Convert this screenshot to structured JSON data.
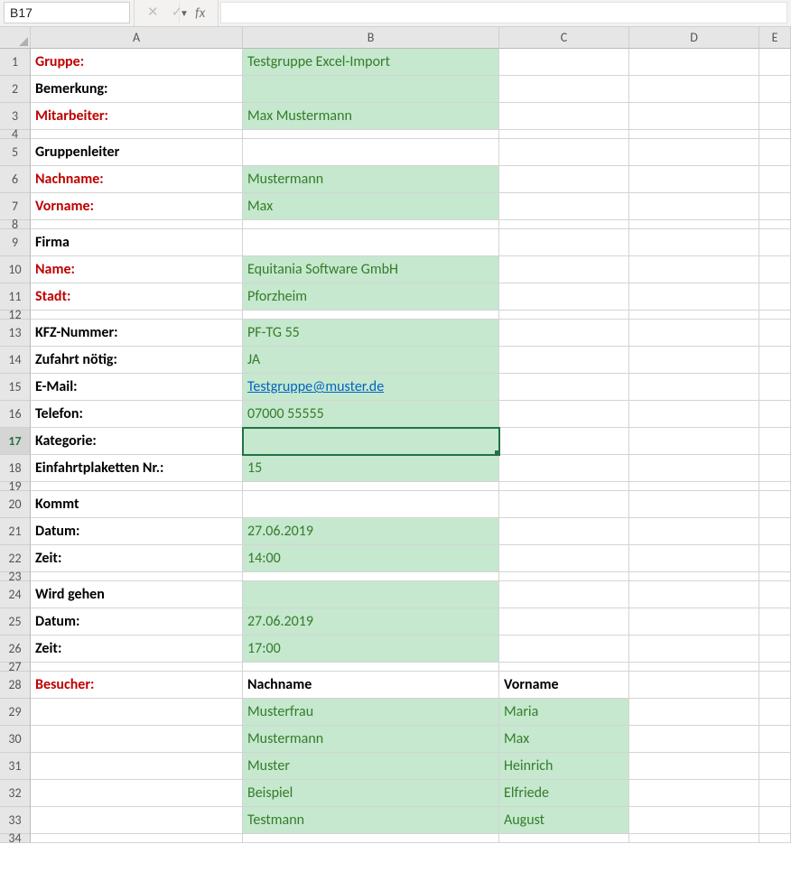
{
  "nameBox": "B17",
  "fx": "fx",
  "cols": [
    "A",
    "B",
    "C",
    "D",
    "E"
  ],
  "rows": [
    {
      "n": "1",
      "h": "rowH",
      "a": "Gruppe:",
      "aCls": "redA",
      "b": "Testgruppe Excel-Import",
      "bCls": "greenB",
      "c": "",
      "cCls": ""
    },
    {
      "n": "2",
      "h": "rowH",
      "a": "Bemerkung:",
      "aCls": "boldA",
      "b": "",
      "bCls": "greenB",
      "c": "",
      "cCls": ""
    },
    {
      "n": "3",
      "h": "rowH",
      "a": "Mitarbeiter:",
      "aCls": "redA",
      "b": "Max Mustermann",
      "bCls": "greenB",
      "c": "",
      "cCls": ""
    },
    {
      "n": "4",
      "h": "rowHs",
      "a": "",
      "aCls": "",
      "b": "",
      "bCls": "",
      "c": "",
      "cCls": ""
    },
    {
      "n": "5",
      "h": "rowH",
      "a": "Gruppenleiter",
      "aCls": "boldA",
      "b": "",
      "bCls": "",
      "c": "",
      "cCls": ""
    },
    {
      "n": "6",
      "h": "rowH",
      "a": "Nachname:",
      "aCls": "redA",
      "b": "Mustermann",
      "bCls": "greenB",
      "c": "",
      "cCls": ""
    },
    {
      "n": "7",
      "h": "rowH",
      "a": "Vorname:",
      "aCls": "redA",
      "b": "Max",
      "bCls": "greenB",
      "c": "",
      "cCls": ""
    },
    {
      "n": "8",
      "h": "rowHs",
      "a": "",
      "aCls": "",
      "b": "",
      "bCls": "",
      "c": "",
      "cCls": ""
    },
    {
      "n": "9",
      "h": "rowH",
      "a": "Firma",
      "aCls": "boldA",
      "b": "",
      "bCls": "",
      "c": "",
      "cCls": ""
    },
    {
      "n": "10",
      "h": "rowH",
      "a": "Name:",
      "aCls": "redA",
      "b": "Equitania Software GmbH",
      "bCls": "greenB",
      "c": "",
      "cCls": ""
    },
    {
      "n": "11",
      "h": "rowH",
      "a": "Stadt:",
      "aCls": "redA",
      "b": "Pforzheim",
      "bCls": "greenB",
      "c": "",
      "cCls": ""
    },
    {
      "n": "12",
      "h": "rowHs",
      "a": "",
      "aCls": "",
      "b": "",
      "bCls": "",
      "c": "",
      "cCls": ""
    },
    {
      "n": "13",
      "h": "rowH",
      "a": "KFZ-Nummer:",
      "aCls": "boldA",
      "b": "PF-TG 55",
      "bCls": "greenB",
      "c": "",
      "cCls": ""
    },
    {
      "n": "14",
      "h": "rowH",
      "a": "Zufahrt nötig:",
      "aCls": "boldA",
      "b": "JA",
      "bCls": "greenB",
      "c": "",
      "cCls": ""
    },
    {
      "n": "15",
      "h": "rowH",
      "a": "E-Mail:",
      "aCls": "boldA",
      "b": "Testgruppe@muster.de",
      "bCls": "greenB linkB",
      "c": "",
      "cCls": ""
    },
    {
      "n": "16",
      "h": "rowH",
      "a": "Telefon:",
      "aCls": "boldA",
      "b": "07000 55555",
      "bCls": "greenB",
      "c": "",
      "cCls": ""
    },
    {
      "n": "17",
      "h": "rowH",
      "a": "Kategorie:",
      "aCls": "boldA",
      "b": "",
      "bCls": "greenB activeSel",
      "c": "",
      "cCls": ""
    },
    {
      "n": "18",
      "h": "rowH",
      "a": "Einfahrtplaketten Nr.:",
      "aCls": "boldA",
      "b": "15",
      "bCls": "greenB",
      "c": "",
      "cCls": ""
    },
    {
      "n": "19",
      "h": "rowHs",
      "a": "",
      "aCls": "",
      "b": "",
      "bCls": "",
      "c": "",
      "cCls": ""
    },
    {
      "n": "20",
      "h": "rowH",
      "a": "Kommt",
      "aCls": "boldA",
      "b": "",
      "bCls": "",
      "c": "",
      "cCls": ""
    },
    {
      "n": "21",
      "h": "rowH",
      "a": "Datum:",
      "aCls": "boldA",
      "b": "27.06.2019",
      "bCls": "greenB",
      "c": "",
      "cCls": ""
    },
    {
      "n": "22",
      "h": "rowH",
      "a": "Zeit:",
      "aCls": "boldA",
      "b": "14:00",
      "bCls": "greenB",
      "c": "",
      "cCls": ""
    },
    {
      "n": "23",
      "h": "rowHs",
      "a": "",
      "aCls": "",
      "b": "",
      "bCls": "",
      "c": "",
      "cCls": ""
    },
    {
      "n": "24",
      "h": "rowH",
      "a": "Wird gehen",
      "aCls": "boldA",
      "b": "",
      "bCls": "greenB",
      "c": "",
      "cCls": ""
    },
    {
      "n": "25",
      "h": "rowH",
      "a": "Datum:",
      "aCls": "boldA",
      "b": "27.06.2019",
      "bCls": "greenB",
      "c": "",
      "cCls": ""
    },
    {
      "n": "26",
      "h": "rowH",
      "a": "Zeit:",
      "aCls": "boldA",
      "b": "17:00",
      "bCls": "greenB",
      "c": "",
      "cCls": ""
    },
    {
      "n": "27",
      "h": "rowHs",
      "a": "",
      "aCls": "",
      "b": "",
      "bCls": "",
      "c": "",
      "cCls": ""
    },
    {
      "n": "28",
      "h": "rowH",
      "a": "Besucher:",
      "aCls": "redA",
      "b": "Nachname",
      "bCls": "boldHdr",
      "c": "Vorname",
      "cCls": "boldHdr"
    },
    {
      "n": "29",
      "h": "rowH",
      "a": "",
      "aCls": "",
      "b": "Musterfrau",
      "bCls": "greenB",
      "c": "Maria",
      "cCls": "greenB"
    },
    {
      "n": "30",
      "h": "rowH",
      "a": "",
      "aCls": "",
      "b": "Mustermann",
      "bCls": "greenB",
      "c": "Max",
      "cCls": "greenB"
    },
    {
      "n": "31",
      "h": "rowH",
      "a": "",
      "aCls": "",
      "b": "Muster",
      "bCls": "greenB",
      "c": "Heinrich",
      "cCls": "greenB"
    },
    {
      "n": "32",
      "h": "rowH",
      "a": "",
      "aCls": "",
      "b": "Beispiel",
      "bCls": "greenB",
      "c": "Elfriede",
      "cCls": "greenB"
    },
    {
      "n": "33",
      "h": "rowH",
      "a": "",
      "aCls": "",
      "b": "Testmann",
      "bCls": "greenB",
      "c": "August",
      "cCls": "greenB"
    },
    {
      "n": "34",
      "h": "rowHs",
      "a": "",
      "aCls": "",
      "b": "",
      "bCls": "",
      "c": "",
      "cCls": ""
    }
  ]
}
